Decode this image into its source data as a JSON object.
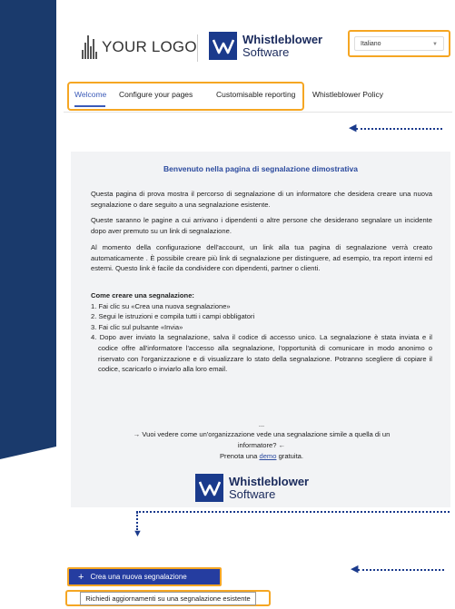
{
  "colors": {
    "navy": "#1a3a6c",
    "accent_orange": "#f5a623",
    "brand_blue": "#253da0",
    "title_blue": "#2b4a9e",
    "content_bg": "#f2f3f5"
  },
  "header": {
    "placeholder_logo_text": "YOUR LOGO",
    "placeholder_logo_icon": "sound-bars-icon",
    "brand_logo_icon": "whistleblower-w-icon",
    "brand_name_line1": "Whistleblower",
    "brand_name_line2": "Software",
    "language_select": {
      "value": "Italiano",
      "icon": "chevron-down-icon"
    }
  },
  "tabs": [
    {
      "label": "Welcome",
      "active": true
    },
    {
      "label": "Configure your pages",
      "active": false
    },
    {
      "label": "Customisable reporting",
      "active": false
    },
    {
      "label": "Whistleblower Policy",
      "active": false
    }
  ],
  "content": {
    "title": "Benvenuto nella pagina di segnalazione dimostrativa",
    "paragraphs": [
      "Questa pagina di prova mostra il percorso di segnalazione di un informatore che desidera creare una nuova segnalazione o dare seguito a una segnalazione esistente.",
      "Queste saranno le pagine a cui arrivano i dipendenti o altre persone che desiderano segnalare un incidente dopo aver premuto su un link di segnalazione.",
      "Al momento della configurazione dell'account, un link alla tua pagina di segnalazione verrà creato automaticamente . È possibile creare più link di segnalazione per distinguere, ad esempio, tra report interni ed esterni. Questo link è facile da condividere con dipendenti, partner o clienti."
    ],
    "how_to_title": "Come creare una segnalazione:",
    "steps": [
      "1. Fai clic su «Crea una nuova segnalazione»",
      "2. Segui le istruzioni e compila tutti i campi obbligatori",
      "3. Fai clic sul pulsante «Invia»",
      "4. Dopo aver inviato la segnalazione, salva il codice di accesso unico. La segnalazione è stata inviata e il codice offre all'informatore l'accesso alla segnalazione, l'opportunità di comunicare in modo anonimo o riservato con l'organizzazione e di visualizzare lo stato della segnalazione. Potranno scegliere di copiare il codice, scaricarlo o inviarlo alla loro email."
    ],
    "ellipsis": "...",
    "question": "→ Vuoi vedere come un'organizzazione vede una segnalazione simile a quella di un informatore? ←",
    "demo_prefix": "Prenota una ",
    "demo_link": "demo",
    "demo_suffix": " gratuita."
  },
  "actions": {
    "create_icon": "plus-icon",
    "create_label": "Crea una nuova segnalazione",
    "update_label": "Richiedi aggiornamenti su una segnalazione esistente"
  },
  "annotations": {
    "arrow_icon": "arrow-left-icon",
    "down_arrow_icon": "arrow-down-icon"
  }
}
